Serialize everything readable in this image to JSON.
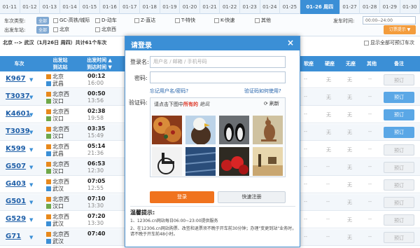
{
  "dates": [
    "01-11",
    "01-12",
    "01-13",
    "01-14",
    "01-15",
    "01-16",
    "01-17",
    "01-18",
    "01-19",
    "01-20",
    "01-21",
    "01-22",
    "01-23",
    "01-24",
    "01-25",
    "01-26 周四",
    "01-27",
    "01-28",
    "01-29",
    "01-30"
  ],
  "filters": {
    "train_type_label": "车次类型:",
    "station_label": "出发车站:",
    "all_tag": "全部",
    "types": [
      "GC-高铁/城际",
      "D-动车",
      "Z-直达",
      "T-特快",
      "K-快速",
      "其他"
    ],
    "stations": [
      "北京",
      "北京西"
    ],
    "depart_time_label": "发车时间:",
    "depart_time_value": "00:00--24:00",
    "subscribe_button": "订票提示 ▼"
  },
  "info": {
    "route": "北京 --> 武汉（1月26日 周四）共计61个车次",
    "show_all": "显示全部可预订车次"
  },
  "table_headers": {
    "train": "车次",
    "stations": [
      "出发站",
      "到达站"
    ],
    "times": [
      "出发时间 ▲",
      "到达时间 ▼"
    ],
    "soft_seat": "软座",
    "hard_seat": "硬座",
    "no_seat": "无座",
    "other": "其他",
    "remark": "备注"
  },
  "rows": [
    {
      "train": "K967",
      "from": "北京",
      "to": "武昌",
      "dep": "00:12",
      "arr": "16:00",
      "from_ic": "s",
      "to_ic": "e",
      "soft": "--",
      "hard": "无",
      "none": "无",
      "other": "--",
      "book": "预订",
      "avail": false
    },
    {
      "train": "T3037",
      "from": "北京西",
      "to": "汉口",
      "dep": "00:50",
      "arr": "13:56",
      "from_ic": "s",
      "to_ic": "p",
      "soft": "--",
      "hard": "无",
      "none": "无",
      "other": "--",
      "book": "预订",
      "avail": true
    },
    {
      "train": "K4601",
      "from": "北京西",
      "to": "汉口",
      "dep": "02:38",
      "arr": "19:58",
      "from_ic": "s",
      "to_ic": "p",
      "soft": "--",
      "hard": "无",
      "none": "无",
      "other": "--",
      "book": "预订",
      "avail": true
    },
    {
      "train": "T3039",
      "from": "北京西",
      "to": "汉口",
      "dep": "03:35",
      "arr": "15:49",
      "from_ic": "s",
      "to_ic": "p",
      "soft": "--",
      "hard": "无",
      "none": "无",
      "other": "--",
      "book": "预订",
      "avail": true
    },
    {
      "train": "K599",
      "from": "北京西",
      "to": "武昌",
      "dep": "05:14",
      "arr": "21:36",
      "from_ic": "s",
      "to_ic": "e",
      "soft": "--",
      "hard": "无",
      "none": "无",
      "other": "--",
      "book": "预订",
      "avail": false
    },
    {
      "train": "G507",
      "from": "北京西",
      "to": "汉口",
      "dep": "06:53",
      "arr": "12:30",
      "from_ic": "s",
      "to_ic": "p",
      "soft": "--",
      "hard": "--",
      "none": "无",
      "other": "--",
      "book": "预订",
      "avail": false
    },
    {
      "train": "G403",
      "from": "北京西",
      "to": "武汉",
      "dep": "07:05",
      "arr": "12:55",
      "from_ic": "s",
      "to_ic": "e",
      "soft": "--",
      "hard": "--",
      "none": "无",
      "other": "--",
      "book": "预订",
      "avail": false
    },
    {
      "train": "G501",
      "from": "北京西",
      "to": "汉口",
      "dep": "07:10",
      "arr": "13:30",
      "from_ic": "s",
      "to_ic": "p",
      "soft": "--",
      "hard": "--",
      "none": "无",
      "other": "--",
      "book": "预订",
      "avail": false
    },
    {
      "train": "G529",
      "from": "北京西",
      "to": "武汉",
      "dep": "07:20",
      "arr": "13:30",
      "from_ic": "s",
      "to_ic": "e",
      "soft": "--",
      "hard": "--",
      "none": "无",
      "other": "--",
      "book": "预订",
      "avail": false
    },
    {
      "train": "G71",
      "from": "北京西",
      "to": "武汉",
      "dep": "07:40",
      "arr": "",
      "from_ic": "s",
      "to_ic": "e",
      "soft": "--",
      "hard": "--",
      "none": "无",
      "other": "--",
      "book": "预订",
      "avail": false
    }
  ],
  "dialog": {
    "title": "请登录",
    "close": "×",
    "username_label": "登录名:",
    "username_placeholder": "用户名 / 邮箱 / 手机号码",
    "password_label": "密码:",
    "forgot_link": "忘记用户名/密码?",
    "captcha_help_link": "验证码如何使用?",
    "captcha_label": "验证码:",
    "captcha_prompt_pre": "请点击下图中",
    "captcha_prompt_bold": "所有的",
    "captcha_prompt_word": "銫凨",
    "refresh": "刷新",
    "login_button": "登录",
    "register_button": "快速注册",
    "tips_title": "温馨提示:",
    "tips": [
      "1、12306.cn网站每日06:00~23:00提供服务",
      "2、在12306.cn网站购票、改签和退票须不晚于开车前30分钟；办理\"变更到站\"业务时，请不晚于开车前48小时。"
    ],
    "captcha_tiles": [
      "pizza",
      "eagle",
      "penguins",
      "kangaroo",
      "wheelchair",
      "denim",
      "apples",
      "desert"
    ]
  },
  "colors": {
    "primary": "#3b8fd6",
    "orange": "#f0731e",
    "link": "#1f5fa8"
  }
}
